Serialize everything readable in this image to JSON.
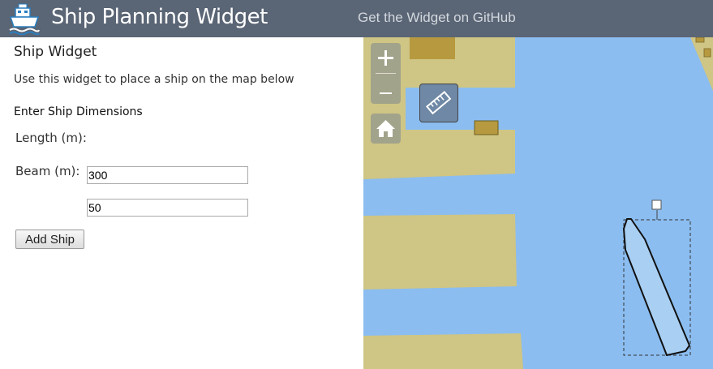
{
  "header": {
    "title": "Ship Planning Widget",
    "github_link": "Get the Widget on GitHub"
  },
  "widget": {
    "title": "Ship Widget",
    "description": "Use this widget to place a ship on the map below",
    "section_heading": "Enter Ship Dimensions",
    "length_label": "Length (m):",
    "length_value": "300",
    "beam_label": "Beam (m):",
    "beam_value": "50",
    "add_button": "Add Ship"
  },
  "map": {
    "controls": [
      "zoom-in",
      "zoom-out",
      "home",
      "measure"
    ],
    "colors": {
      "water": "#8bbdf0",
      "land": "#cfc584",
      "building": "#b7993f",
      "ship_fill": "#a9cff3",
      "header": "#5a6575"
    }
  }
}
